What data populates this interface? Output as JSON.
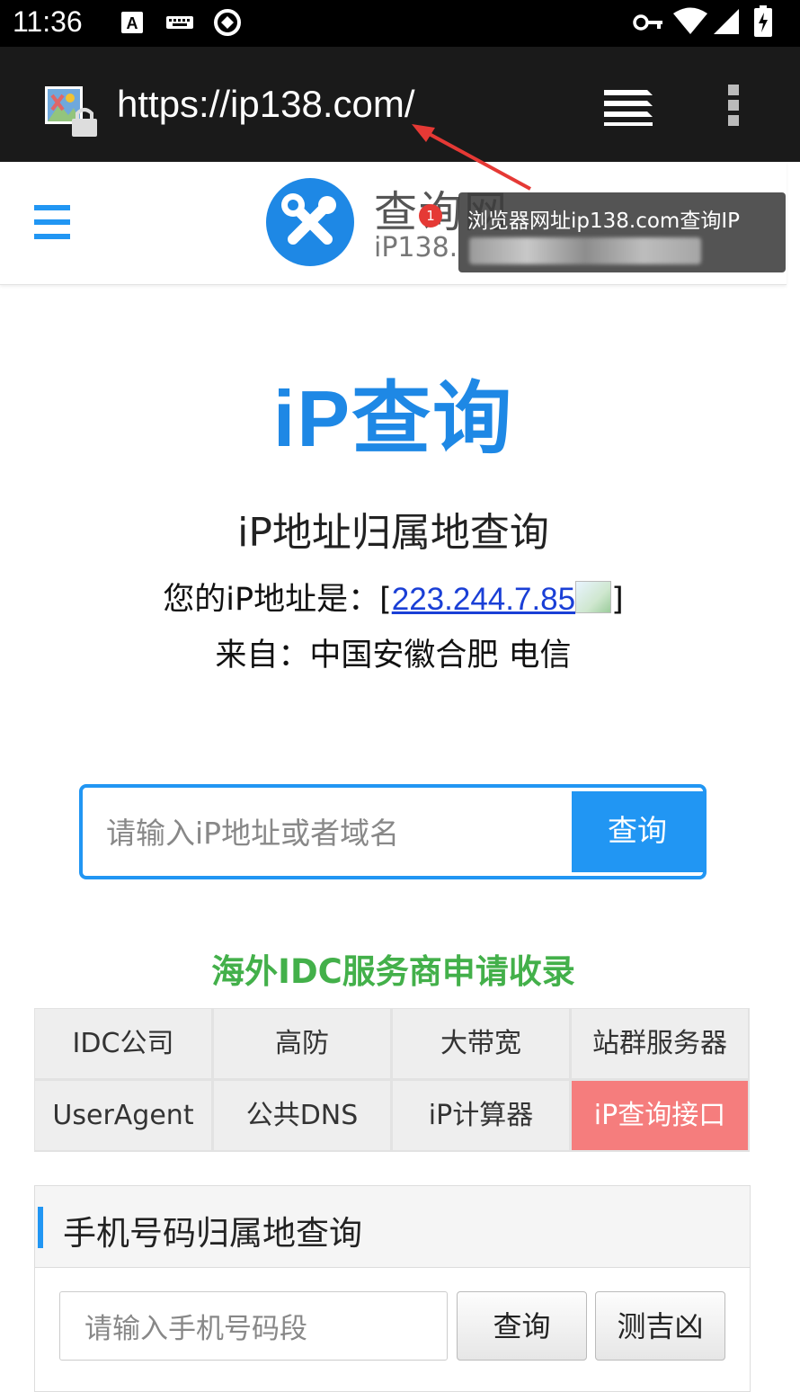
{
  "status_bar": {
    "time": "11:36",
    "icons": [
      "a-notification-icon",
      "keyboard-icon",
      "sync-icon",
      "vpn-key-icon",
      "wifi-icon",
      "signal-icon",
      "battery-charging-icon"
    ]
  },
  "browser": {
    "url": "https://ip138.com/",
    "icons": [
      "site-security-icon",
      "tabs-icon",
      "overflow-menu-icon"
    ]
  },
  "site_header": {
    "logo_text_cn": "查询网",
    "logo_text_en": "iP138.",
    "annotation": {
      "badge": "1",
      "text": "浏览器网址ip138.com查询IP"
    }
  },
  "hero": {
    "title": "iP查询",
    "subtitle": "iP地址归属地查询",
    "ip_prefix": "您的iP地址是：[",
    "ip_value": "223.244.7.85",
    "ip_suffix": "]",
    "from_text": "来自：中国安徽合肥 电信"
  },
  "search": {
    "placeholder": "请输入iP地址或者域名",
    "button": "查询"
  },
  "idc": {
    "title": "海外IDC服务商申请收录",
    "links": [
      "IDC公司",
      "高防",
      "大带宽",
      "站群服务器",
      "UserAgent",
      "公共DNS",
      "iP计算器",
      "iP查询接口"
    ],
    "highlight_color": "#f57d7d"
  },
  "phone": {
    "title": "手机号码归属地查询",
    "placeholder": "请输入手机号码段",
    "query_button": "查询",
    "fortune_button": "测吉凶"
  },
  "colors": {
    "accent": "#2196f3",
    "green": "#43b04a"
  }
}
